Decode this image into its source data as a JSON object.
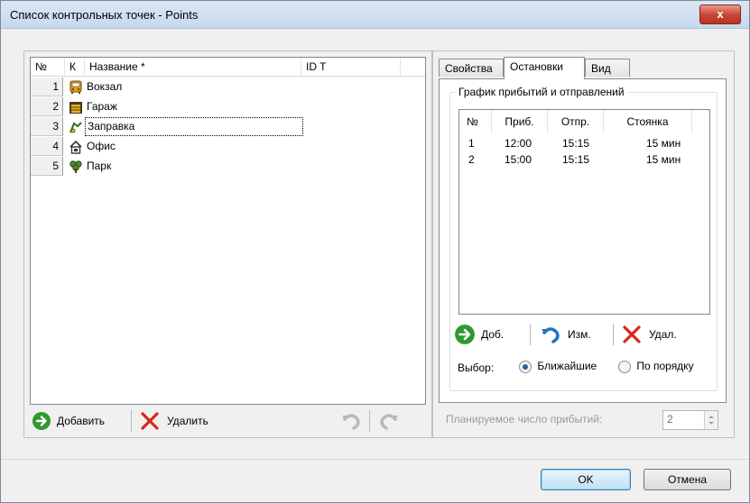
{
  "window": {
    "title": "Список контрольных точек - Points",
    "close_label": "x"
  },
  "points_list": {
    "columns": [
      "№",
      "К",
      "Название *",
      "ID T"
    ],
    "rows": [
      {
        "num": "1",
        "icon": "bus-station-icon",
        "name": "Вокзал"
      },
      {
        "num": "2",
        "icon": "garage-icon",
        "name": "Гараж"
      },
      {
        "num": "3",
        "icon": "gas-station-icon",
        "name": "Заправка"
      },
      {
        "num": "4",
        "icon": "office-icon",
        "name": "Офис"
      },
      {
        "num": "5",
        "icon": "park-tree-icon",
        "name": "Парк"
      }
    ],
    "add_label": "Добавить",
    "delete_label": "Удалить"
  },
  "tabs": {
    "items": [
      "Свойства",
      "Остановки",
      "Вид"
    ],
    "active": "Остановки"
  },
  "schedule": {
    "legend": "График прибытий и отправлений",
    "columns": [
      "№",
      "Приб.",
      "Отпр.",
      "Стоянка"
    ],
    "rows": [
      {
        "num": "1",
        "arrive": "12:00",
        "depart": "15:15",
        "stop": "15 мин"
      },
      {
        "num": "2",
        "arrive": "15:00",
        "depart": "15:15",
        "stop": "15 мин"
      }
    ],
    "add_label": "Доб.",
    "edit_label": "Изм.",
    "delete_label": "Удал.",
    "choice_label": "Выбор:",
    "choice_nearest": "Ближайшие",
    "choice_order": "По порядку",
    "selected_choice": "Ближайшие"
  },
  "planned": {
    "label": "Планируемое число прибытий:",
    "value": "2"
  },
  "footer": {
    "ok_label": "OK",
    "cancel_label": "Отмена"
  },
  "colors": {
    "accent_green": "#2e9a2e",
    "delete_red": "#d9261c",
    "undo_blue": "#1f73c8"
  }
}
